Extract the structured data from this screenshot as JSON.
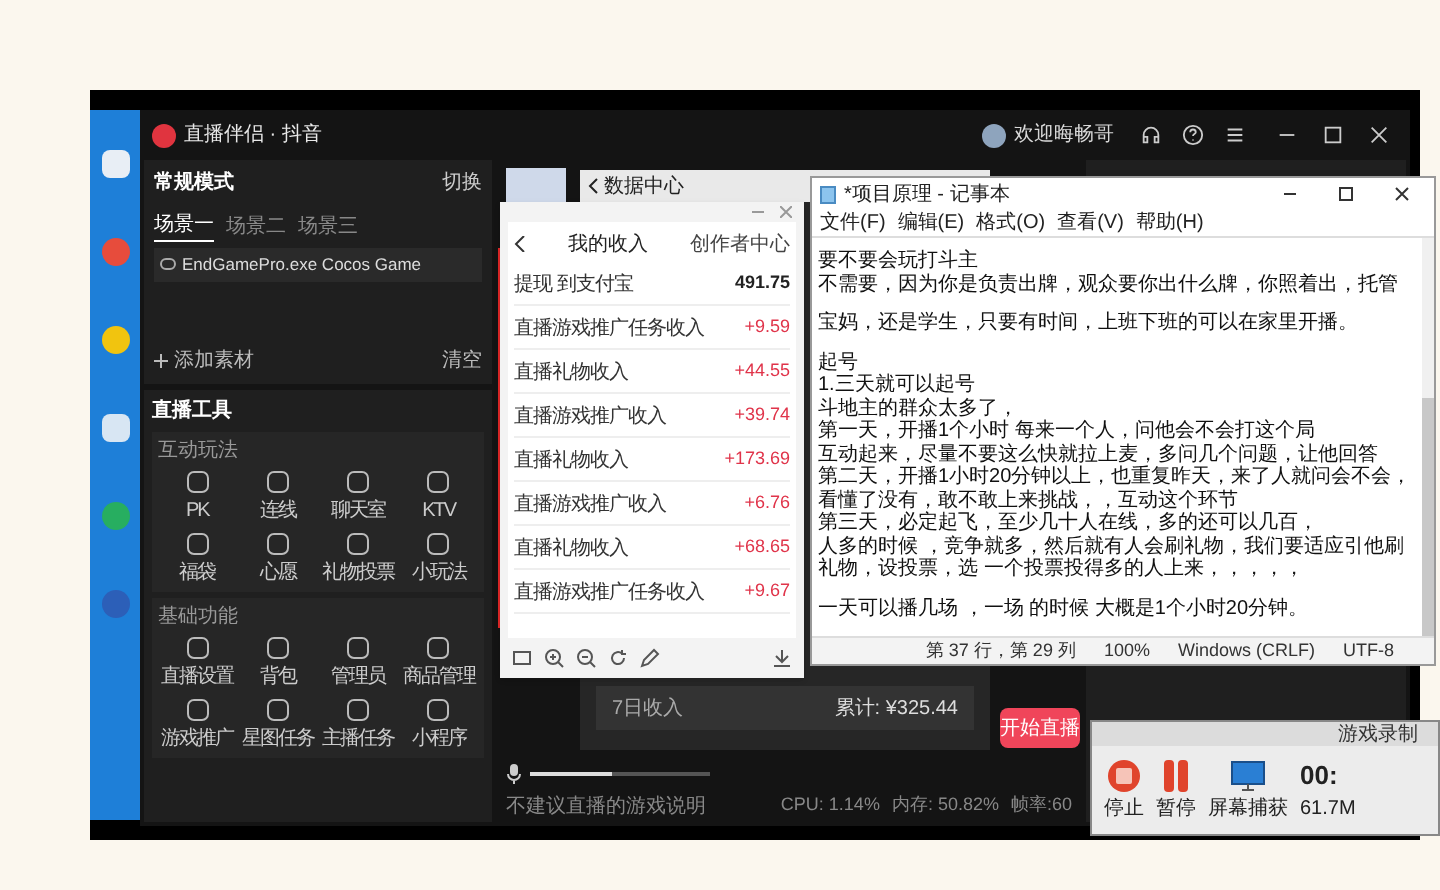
{
  "app": {
    "title": "直播伴侣 · 抖音",
    "user": "欢迎晦畅哥"
  },
  "scene_panel": {
    "mode": "常规模式",
    "switch": "切换",
    "tabs": [
      {
        "label": "场景一",
        "selected": true
      },
      {
        "label": "场景二",
        "selected": false
      },
      {
        "label": "场景三",
        "selected": false
      }
    ],
    "sources": [
      "EndGamePro.exe Cocos Game"
    ],
    "add_source": "添加素材",
    "clear": "清空"
  },
  "tools": {
    "title": "直播工具",
    "groups": [
      {
        "title": "互动玩法",
        "items": [
          "PK",
          "连线",
          "聊天室",
          "KTV",
          "福袋",
          "心愿",
          "礼物投票",
          "小玩法"
        ]
      },
      {
        "title": "基础功能",
        "items": [
          "直播设置",
          "背包",
          "管理员",
          "商品管理",
          "游戏推广",
          "星图任务",
          "主播任务",
          "小程序"
        ]
      }
    ]
  },
  "income_window": {
    "title": "数据中心",
    "summary_label": "7日收入",
    "total": "累计: ¥325.44"
  },
  "image_viewer": {
    "header": "我的收入",
    "link": "创作者中心",
    "rows": [
      {
        "title": "提现 到支付宝",
        "amount": "491.75",
        "kind": "withdraw"
      },
      {
        "title": "直播游戏推广任务收入",
        "amount": "+9.59",
        "kind": "income"
      },
      {
        "title": "直播礼物收入",
        "amount": "+44.55",
        "kind": "income"
      },
      {
        "title": "直播游戏推广收入",
        "amount": "+39.74",
        "kind": "income"
      },
      {
        "title": "直播礼物收入",
        "amount": "+173.69",
        "kind": "income"
      },
      {
        "title": "直播游戏推广收入",
        "amount": "+6.76",
        "kind": "income"
      },
      {
        "title": "直播礼物收入",
        "amount": "+68.65",
        "kind": "income"
      },
      {
        "title": "直播游戏推广任务收入",
        "amount": "+9.67",
        "kind": "income"
      }
    ]
  },
  "notepad": {
    "title": "*项目原理 - 记事本",
    "menu": [
      "文件(F)",
      "编辑(E)",
      "格式(O)",
      "查看(V)",
      "帮助(H)"
    ],
    "paragraphs": [
      [
        "要不要会玩打斗主",
        "不需要，因为你是负责出牌，观众要你出什么牌，你照着出，托管"
      ],
      [
        "宝妈，还是学生，只要有时间，上班下班的可以在家里开播。"
      ],
      [
        "起号",
        "1.三天就可以起号",
        "斗地主的群众太多了，",
        "第一天，开播1个小时  每来一个人，问他会不会打这个局",
        "互动起来，尽量不要这么快就拉上麦，多问几个问题，让他回答",
        "第二天，开播1小时20分钟以上，也重复昨天，来了人就问会不会，",
        "看懂了没有，敢不敢上来挑战，，互动这个环节",
        "第三天，必定起飞，至少几十人在线，多的还可以几百，",
        "人多的时候 ，竞争就多，然后就有人会刷礼物，我们要适应引他刷",
        "礼物，设投票，选 一个投票投得多的人上来，，，，，"
      ],
      [
        "一天可以播几场 ，一场 的时候 大概是1个小时20分钟。"
      ]
    ],
    "status": [
      "第 37 行，第 29 列",
      "100%",
      "Windows (CRLF)",
      "UTF-8"
    ]
  },
  "live": {
    "volume": {
      "level": 0.45
    },
    "start_button": "开始直播",
    "notice": "不建议直播的游戏说明",
    "stats": [
      "CPU: 1.14%",
      "内存: 50.82%",
      "帧率:60"
    ]
  },
  "recorder": {
    "tabs": [
      "游戏录制"
    ],
    "buttons": [
      {
        "label": "停止",
        "kind": "stop"
      },
      {
        "label": "暂停",
        "kind": "pause"
      },
      {
        "label": "屏幕捕获",
        "kind": "capture"
      }
    ],
    "time": "00:",
    "size": "61.7M"
  }
}
